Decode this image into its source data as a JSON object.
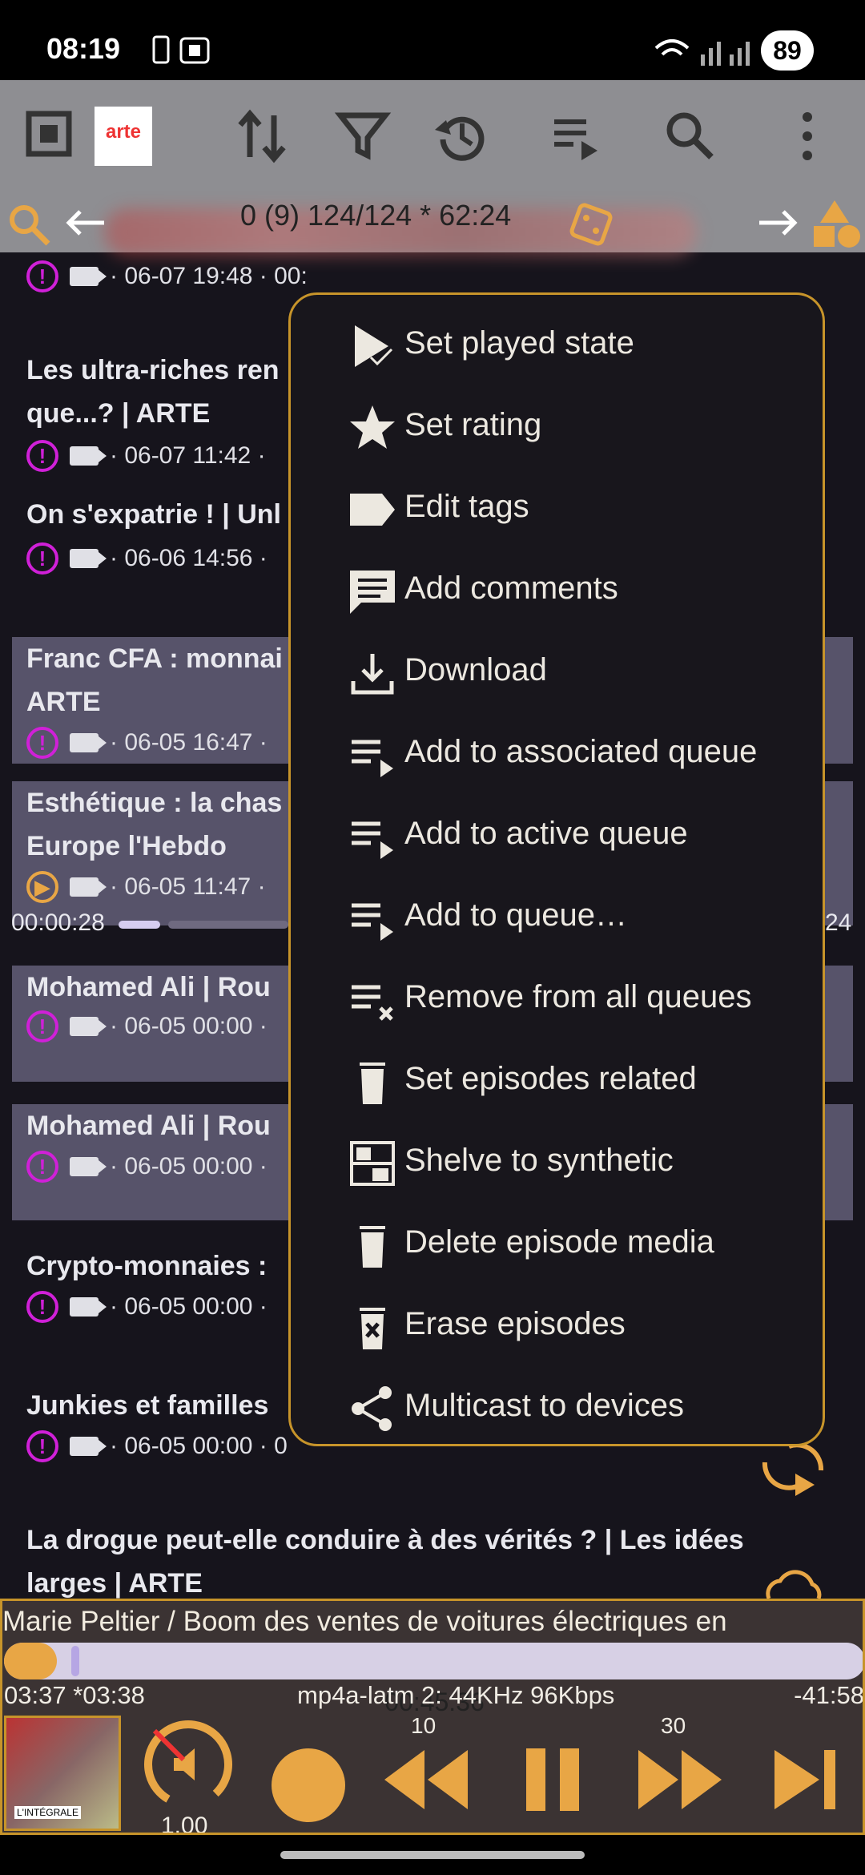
{
  "status_bar": {
    "time": "08:19",
    "battery": "89"
  },
  "toolbar": {
    "logo": "arte",
    "filter_stats": "0 (9)   124/124 * 62:24"
  },
  "episodes": [
    {
      "title": "",
      "meta": "· 06-07 19:48 · 00:"
    },
    {
      "title": "Les ultra-riches ren\nque...? | ARTE",
      "meta": "· 06-07 11:42 ·"
    },
    {
      "title": "On s'expatrie ! | Unl",
      "meta": "· 06-06 14:56 ·"
    },
    {
      "title": "Franc CFA : monnai\nARTE",
      "meta": "· 06-05 16:47 ·"
    },
    {
      "title": "Esthétique : la chas\nEurope l'Hebdo",
      "meta": "· 06-05 11:47 ·",
      "progress_time": "00:00:28",
      "progress_end": "24"
    },
    {
      "title": "Mohamed Ali | Rou",
      "meta": "· 06-05 00:00 ·"
    },
    {
      "title": "Mohamed Ali | Rou",
      "meta": "· 06-05 00:00 ·"
    },
    {
      "title": "Crypto-monnaies :",
      "meta": "· 06-05 00:00 ·"
    },
    {
      "title": "Junkies et familles",
      "meta": "· 06-05 00:00 · 0"
    },
    {
      "title": "La drogue peut-elle conduire à des vérités ? | Les idées\nlarges | ARTE",
      "meta": ""
    }
  ],
  "context_menu": {
    "items": [
      {
        "label": "Set played state",
        "icon": "played-state-icon"
      },
      {
        "label": "Set rating",
        "icon": "star-icon"
      },
      {
        "label": "Edit tags",
        "icon": "tag-icon"
      },
      {
        "label": "Add comments",
        "icon": "comment-icon"
      },
      {
        "label": "Download",
        "icon": "download-icon"
      },
      {
        "label": "Add to associated queue",
        "icon": "queue-add-icon"
      },
      {
        "label": "Add to active queue",
        "icon": "queue-add-icon"
      },
      {
        "label": "Add to queue…",
        "icon": "queue-add-icon"
      },
      {
        "label": "Remove from all queues",
        "icon": "queue-remove-icon"
      },
      {
        "label": "Set episodes related",
        "icon": "trash-icon"
      },
      {
        "label": "Shelve to synthetic",
        "icon": "shelf-icon"
      },
      {
        "label": "Delete episode media",
        "icon": "trash-icon"
      },
      {
        "label": "Erase episodes",
        "icon": "erase-icon"
      },
      {
        "label": "Multicast to devices",
        "icon": "share-icon"
      }
    ]
  },
  "player": {
    "title": "Marie Peltier / Boom des ventes de voitures électriques en",
    "position": "00:45:36",
    "elapsed": "03:37 *03:38",
    "codec": "mp4a-latm 2: 44KHz 96Kbps",
    "remaining": "-41:58",
    "speed": "1.00",
    "rewind_seconds": "10",
    "forward_seconds": "30",
    "thumb_label": "L'INTÉGRALE",
    "accent_color": "#e8a645"
  }
}
